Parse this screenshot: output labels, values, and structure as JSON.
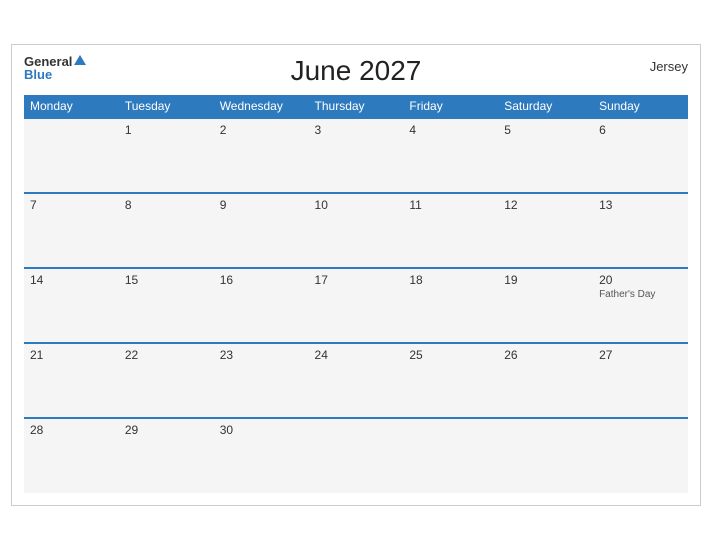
{
  "header": {
    "title": "June 2027",
    "region": "Jersey",
    "logo_general": "General",
    "logo_blue": "Blue"
  },
  "days_of_week": [
    "Monday",
    "Tuesday",
    "Wednesday",
    "Thursday",
    "Friday",
    "Saturday",
    "Sunday"
  ],
  "weeks": [
    [
      {
        "day": "",
        "empty": true
      },
      {
        "day": "1"
      },
      {
        "day": "2"
      },
      {
        "day": "3"
      },
      {
        "day": "4"
      },
      {
        "day": "5"
      },
      {
        "day": "6"
      }
    ],
    [
      {
        "day": "7"
      },
      {
        "day": "8"
      },
      {
        "day": "9"
      },
      {
        "day": "10"
      },
      {
        "day": "11"
      },
      {
        "day": "12"
      },
      {
        "day": "13"
      }
    ],
    [
      {
        "day": "14"
      },
      {
        "day": "15"
      },
      {
        "day": "16"
      },
      {
        "day": "17"
      },
      {
        "day": "18"
      },
      {
        "day": "19"
      },
      {
        "day": "20",
        "event": "Father's Day"
      }
    ],
    [
      {
        "day": "21"
      },
      {
        "day": "22"
      },
      {
        "day": "23"
      },
      {
        "day": "24"
      },
      {
        "day": "25"
      },
      {
        "day": "26"
      },
      {
        "day": "27"
      }
    ],
    [
      {
        "day": "28"
      },
      {
        "day": "29"
      },
      {
        "day": "30"
      },
      {
        "day": "",
        "empty": true
      },
      {
        "day": "",
        "empty": true
      },
      {
        "day": "",
        "empty": true
      },
      {
        "day": "",
        "empty": true
      }
    ]
  ]
}
